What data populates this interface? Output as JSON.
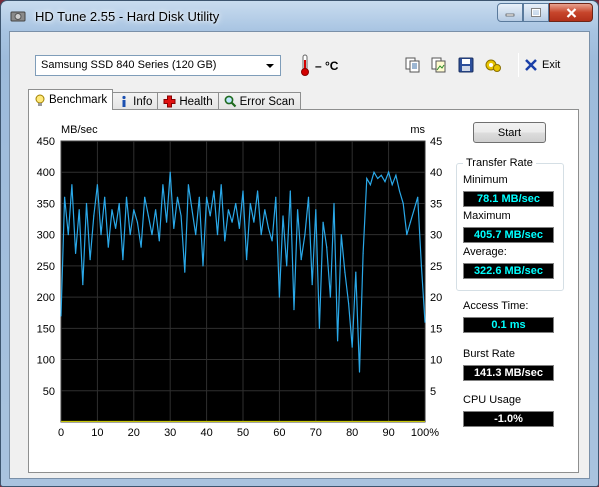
{
  "window": {
    "title": "HD Tune 2.55 - Hard Disk Utility"
  },
  "toolbar": {
    "drive": "Samsung SSD 840 Series (120 GB)",
    "temperature": "– °C",
    "exit_label": "Exit",
    "icons": [
      "copy-text-icon",
      "copy-image-icon",
      "save-icon",
      "options-icon",
      "exit-icon"
    ]
  },
  "tabs": [
    {
      "label": "Benchmark",
      "icon": "benchmark-icon",
      "active": true
    },
    {
      "label": "Info",
      "icon": "info-icon",
      "active": false
    },
    {
      "label": "Health",
      "icon": "health-icon",
      "active": false
    },
    {
      "label": "Error Scan",
      "icon": "error-scan-icon",
      "active": false
    }
  ],
  "benchmark": {
    "start_label": "Start",
    "transfer_rate_title": "Transfer Rate",
    "minimum_label": "Minimum",
    "minimum_value": "78.1 MB/sec",
    "maximum_label": "Maximum",
    "maximum_value": "405.7 MB/sec",
    "average_label": "Average:",
    "average_value": "322.6 MB/sec",
    "access_time_label": "Access Time:",
    "access_time_value": "0.1 ms",
    "burst_rate_label": "Burst Rate",
    "burst_rate_value": "141.3 MB/sec",
    "cpu_usage_label": "CPU Usage",
    "cpu_usage_value": "-1.0%"
  },
  "chart_data": {
    "type": "line",
    "ylabel_left": "MB/sec",
    "ylabel_right": "ms",
    "ylim_left": [
      0,
      450
    ],
    "ylim_right": [
      0,
      45
    ],
    "y_ticks_left": [
      50,
      100,
      150,
      200,
      250,
      300,
      350,
      400,
      450
    ],
    "y_ticks_right": [
      5,
      10,
      15,
      20,
      25,
      30,
      35,
      40,
      45
    ],
    "x_ticks": [
      "0",
      "10",
      "20",
      "30",
      "40",
      "50",
      "60",
      "70",
      "80",
      "90",
      "100%"
    ],
    "xlim": [
      0,
      100
    ],
    "grid": true,
    "series": [
      {
        "color": "#2aa8e8",
        "x": [
          0,
          1,
          2,
          3,
          4,
          5,
          6,
          7,
          8,
          9,
          10,
          11,
          12,
          13,
          14,
          15,
          16,
          17,
          18,
          19,
          20,
          21,
          22,
          23,
          24,
          25,
          26,
          27,
          28,
          29,
          30,
          31,
          32,
          33,
          34,
          35,
          36,
          37,
          38,
          39,
          40,
          41,
          42,
          43,
          44,
          45,
          46,
          47,
          48,
          49,
          50,
          51,
          52,
          53,
          54,
          55,
          56,
          57,
          58,
          59,
          60,
          61,
          62,
          63,
          64,
          65,
          66,
          67,
          68,
          69,
          70,
          71,
          72,
          73,
          74,
          75,
          76,
          77,
          78,
          79,
          80,
          81,
          82,
          83,
          84,
          85,
          86,
          87,
          88,
          89,
          90,
          91,
          92,
          93,
          94,
          95,
          96,
          97,
          98,
          99,
          100
        ],
        "y": [
          170,
          360,
          300,
          380,
          270,
          340,
          220,
          350,
          260,
          330,
          380,
          300,
          360,
          280,
          340,
          310,
          350,
          260,
          360,
          300,
          340,
          320,
          280,
          360,
          330,
          300,
          340,
          290,
          380,
          320,
          400,
          310,
          360,
          330,
          240,
          380,
          340,
          300,
          360,
          250,
          360,
          330,
          370,
          300,
          380,
          290,
          340,
          320,
          350,
          310,
          370,
          260,
          350,
          320,
          370,
          300,
          340,
          310,
          290,
          360,
          200,
          330,
          250,
          370,
          180,
          340,
          260,
          300,
          360,
          220,
          340,
          150,
          320,
          280,
          200,
          350,
          130,
          300,
          240,
          190,
          120,
          240,
          80,
          270,
          390,
          380,
          400,
          390,
          395,
          385,
          400,
          380,
          395,
          370,
          350,
          300,
          320,
          340,
          360,
          250,
          160
        ]
      },
      {
        "color": "#d8d800",
        "x": [
          0,
          10,
          20,
          30,
          40,
          50,
          60,
          70,
          80,
          90,
          100
        ],
        "y": [
          1,
          1,
          1,
          1,
          1,
          1,
          1,
          1,
          1,
          1,
          1
        ]
      }
    ]
  }
}
